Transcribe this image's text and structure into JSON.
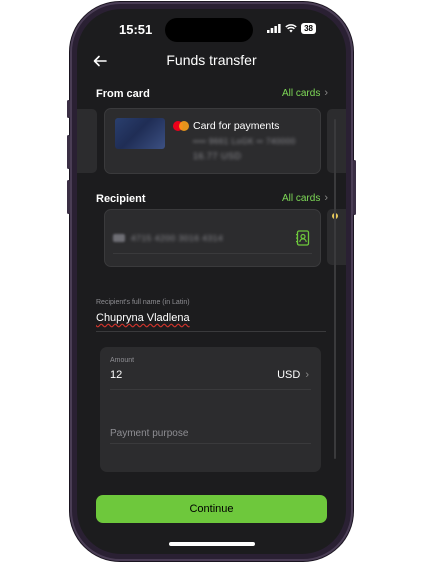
{
  "status": {
    "time": "15:51",
    "battery": "38"
  },
  "header": {
    "title": "Funds transfer"
  },
  "from_card": {
    "label": "From card",
    "all_cards": "All cards",
    "card_name": "Card for payments",
    "card_masked": "•••• 9661 LoGK •• 740000",
    "card_balance": "16.77 USD"
  },
  "recipient": {
    "label": "Recipient",
    "all_cards": "All cards",
    "card_number": "4715 4200 3016 4314"
  },
  "full_name": {
    "label": "Recipient's full name (in Latin)",
    "value": "Chupryna Vladlena"
  },
  "amount": {
    "label": "Amount",
    "value": "12",
    "currency": "USD",
    "purpose_placeholder": "Payment purpose"
  },
  "actions": {
    "continue": "Continue"
  },
  "colors": {
    "accent": "#6ec83c",
    "link": "#7ed957",
    "background": "#1c1c1e"
  }
}
